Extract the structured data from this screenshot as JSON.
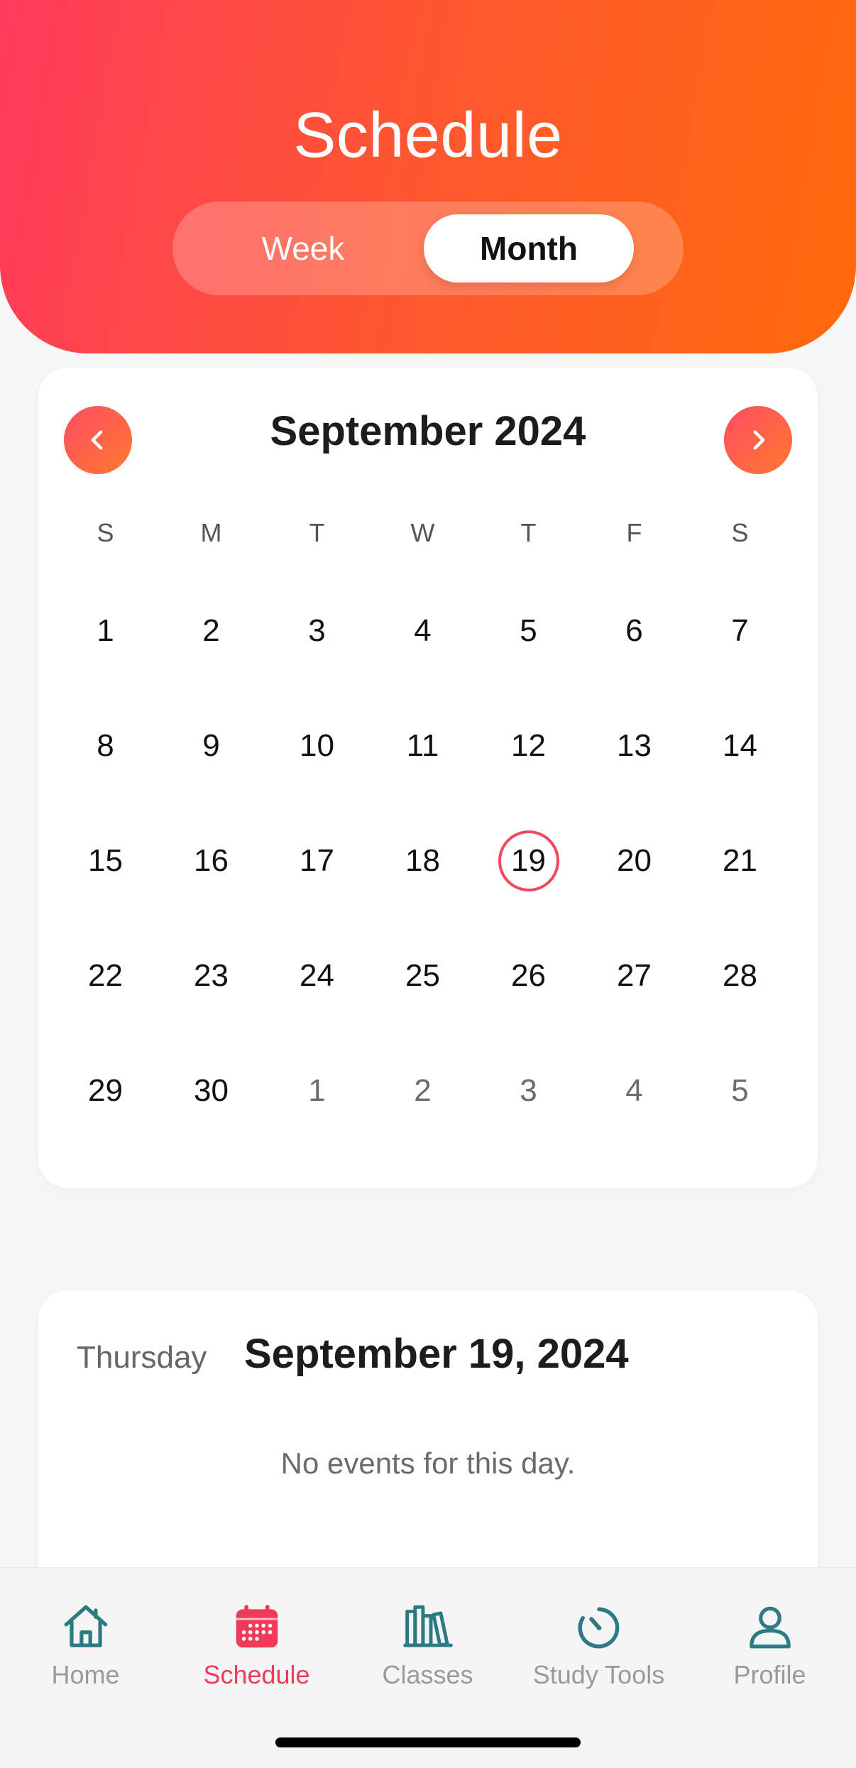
{
  "header": {
    "title": "Schedule",
    "segments": {
      "week": "Week",
      "month": "Month",
      "selected": "Month"
    }
  },
  "calendar": {
    "month_title": "September 2024",
    "weekdays": [
      "S",
      "M",
      "T",
      "W",
      "T",
      "F",
      "S"
    ],
    "weeks": [
      [
        {
          "d": "1"
        },
        {
          "d": "2"
        },
        {
          "d": "3"
        },
        {
          "d": "4"
        },
        {
          "d": "5"
        },
        {
          "d": "6"
        },
        {
          "d": "7"
        }
      ],
      [
        {
          "d": "8"
        },
        {
          "d": "9"
        },
        {
          "d": "10"
        },
        {
          "d": "11"
        },
        {
          "d": "12"
        },
        {
          "d": "13"
        },
        {
          "d": "14"
        }
      ],
      [
        {
          "d": "15"
        },
        {
          "d": "16"
        },
        {
          "d": "17"
        },
        {
          "d": "18"
        },
        {
          "d": "19",
          "selected": true
        },
        {
          "d": "20"
        },
        {
          "d": "21"
        }
      ],
      [
        {
          "d": "22"
        },
        {
          "d": "23"
        },
        {
          "d": "24"
        },
        {
          "d": "25"
        },
        {
          "d": "26"
        },
        {
          "d": "27"
        },
        {
          "d": "28"
        }
      ],
      [
        {
          "d": "29"
        },
        {
          "d": "30"
        },
        {
          "d": "1",
          "other": true
        },
        {
          "d": "2",
          "other": true
        },
        {
          "d": "3",
          "other": true
        },
        {
          "d": "4",
          "other": true
        },
        {
          "d": "5",
          "other": true
        }
      ]
    ],
    "accent_color": "#f2485b"
  },
  "events": {
    "weekday": "Thursday",
    "date": "September 19, 2024",
    "empty_message": "No events for this day."
  },
  "tabbar": {
    "items": [
      {
        "label": "Home",
        "icon": "home-icon",
        "active": false
      },
      {
        "label": "Schedule",
        "icon": "calendar-icon",
        "active": true
      },
      {
        "label": "Classes",
        "icon": "books-icon",
        "active": false
      },
      {
        "label": "Study Tools",
        "icon": "timer-icon",
        "active": false
      },
      {
        "label": "Profile",
        "icon": "user-icon",
        "active": false
      }
    ],
    "active_color": "#f03a5a",
    "icon_color": "#2c7a84"
  }
}
